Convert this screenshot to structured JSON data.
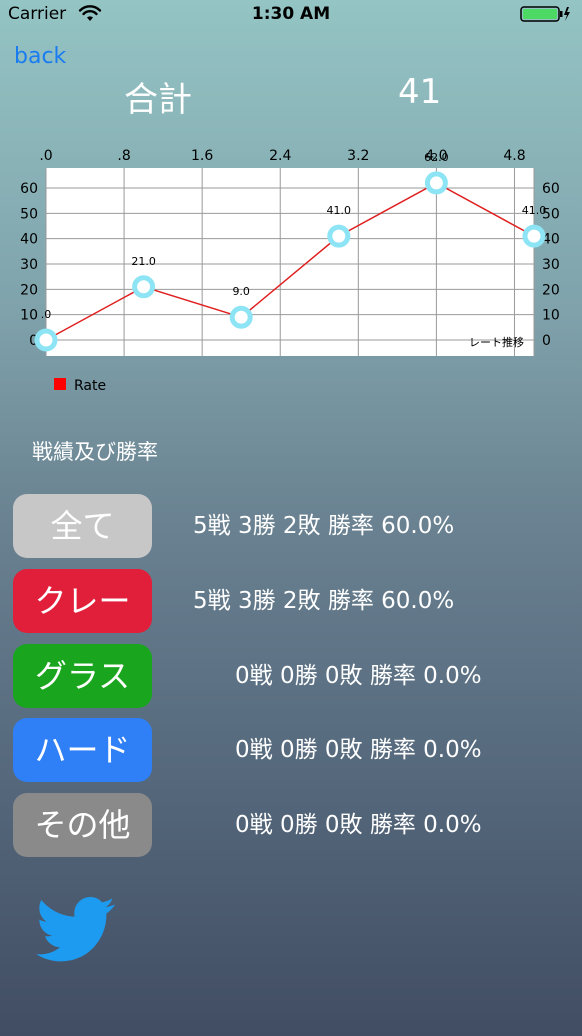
{
  "status": {
    "carrier": "Carrier",
    "time": "1:30 AM",
    "battery_color": "#4cd964"
  },
  "nav": {
    "back_label": "back"
  },
  "total": {
    "label": "合計",
    "value": "41"
  },
  "chart_data": {
    "type": "line",
    "x": [
      0,
      1,
      2,
      3,
      4,
      5
    ],
    "values": [
      0,
      21,
      9,
      41,
      62,
      41
    ],
    "data_labels": [
      ".0",
      "21.0",
      "9.0",
      "41.0",
      "62.0",
      "41.0"
    ],
    "x_tick_labels": [
      ".0",
      ".8",
      "1.6",
      "2.4",
      "3.2",
      "4.0",
      "4.8"
    ],
    "y_tick_labels": [
      "0",
      "10",
      "20",
      "30",
      "40",
      "50",
      "60"
    ],
    "ylim": [
      0,
      65
    ],
    "xlim": [
      0,
      5
    ],
    "description_label": "レート推移",
    "legend": [
      {
        "name": "Rate",
        "color": "#ff0000"
      }
    ],
    "line_color": "#e02020",
    "point_color": "#8de4f4",
    "grid": true
  },
  "section_title": "戦績及び勝率",
  "records": [
    {
      "label": "全て",
      "stats": "5戦 3勝 2敗  勝率 60.0%",
      "color": "#c7c7c7",
      "name": "all"
    },
    {
      "label": "クレー",
      "stats": "5戦 3勝 2敗  勝率 60.0%",
      "color": "#e21f3a",
      "name": "clay"
    },
    {
      "label": "グラス",
      "stats": "0戦 0勝 0敗  勝率 0.0%",
      "color": "#1aa51f",
      "name": "grass"
    },
    {
      "label": "ハード",
      "stats": "0戦 0勝 0敗  勝率 0.0%",
      "color": "#2f7ff7",
      "name": "hard"
    },
    {
      "label": "その他",
      "stats": "0戦 0勝 0敗  勝率 0.0%",
      "color": "#8a8a8a",
      "name": "other"
    }
  ],
  "twitter_color": "#1d9bf0"
}
